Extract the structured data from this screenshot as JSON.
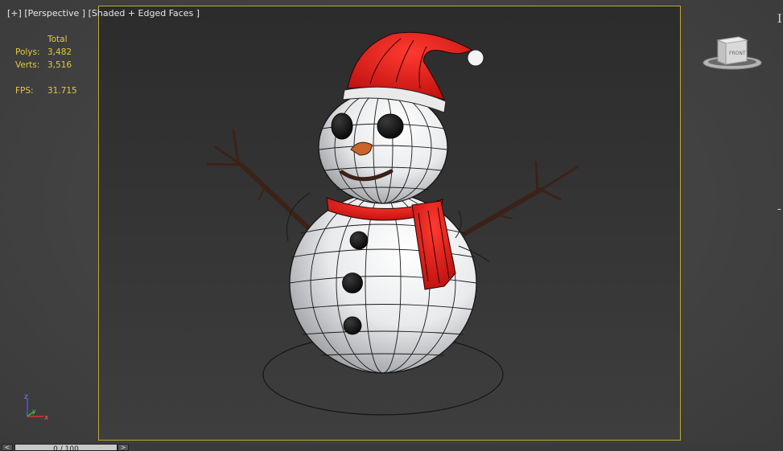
{
  "viewport": {
    "label_plus": "[+]",
    "label_view": "[Perspective ]",
    "label_shading": "[Shaded + Edged Faces ]"
  },
  "stats": {
    "header": "Total",
    "polys_label": "Polys:",
    "polys_value": "3,482",
    "verts_label": "Verts:",
    "verts_value": "3,516",
    "fps_label": "FPS:",
    "fps_value": "31.715"
  },
  "viewcube": {
    "face_label": "FRONT"
  },
  "gizmo": {
    "z": "z",
    "y": "y",
    "x": "x"
  },
  "timeline": {
    "frame_text": "0 / 100",
    "prev": "<",
    "next": ">"
  },
  "colors": {
    "frame_border": "#b9a83a",
    "stats_text": "#e2c93a",
    "hat_red": "#e0191b",
    "snow_white": "#f2f2f2"
  },
  "icons": [
    "viewcube-icon",
    "axis-gizmo-icon"
  ]
}
